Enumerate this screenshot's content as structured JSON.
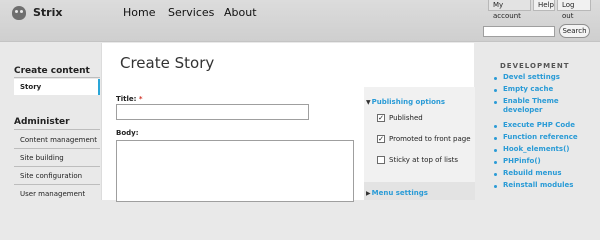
{
  "header": {
    "brand": "Strix",
    "nav": [
      "Home",
      "Services",
      "About"
    ],
    "account_links": [
      "My account",
      "Help",
      "Log out"
    ],
    "search_placeholder": "",
    "search_button": "Search"
  },
  "sidebar": {
    "create_heading": "Create content",
    "create_items": [
      "Story"
    ],
    "admin_heading": "Administer",
    "admin_items": [
      "Content management",
      "Site building",
      "Site configuration",
      "User management"
    ]
  },
  "main": {
    "title": "Create Story",
    "title_label": "Title:",
    "required_marker": "*",
    "title_value": "",
    "body_label": "Body:",
    "body_value": "",
    "publishing": {
      "heading": "Publishing options",
      "options": [
        {
          "label": "Published",
          "checked": true
        },
        {
          "label": "Promoted to front page",
          "checked": true
        },
        {
          "label": "Sticky at top of lists",
          "checked": false
        }
      ]
    },
    "menu_settings": "Menu settings"
  },
  "devel": {
    "heading": "DEVELOPMENT",
    "links": [
      "Devel settings",
      "Empty cache",
      "Enable Theme developer",
      "Execute PHP Code",
      "Function reference",
      "Hook_elements()",
      "PHPinfo()",
      "Rebuild menus",
      "Reinstall modules"
    ]
  },
  "colors": {
    "accent": "#2a9bd6",
    "required": "#d0362a",
    "active_border": "#2aa6d8"
  }
}
